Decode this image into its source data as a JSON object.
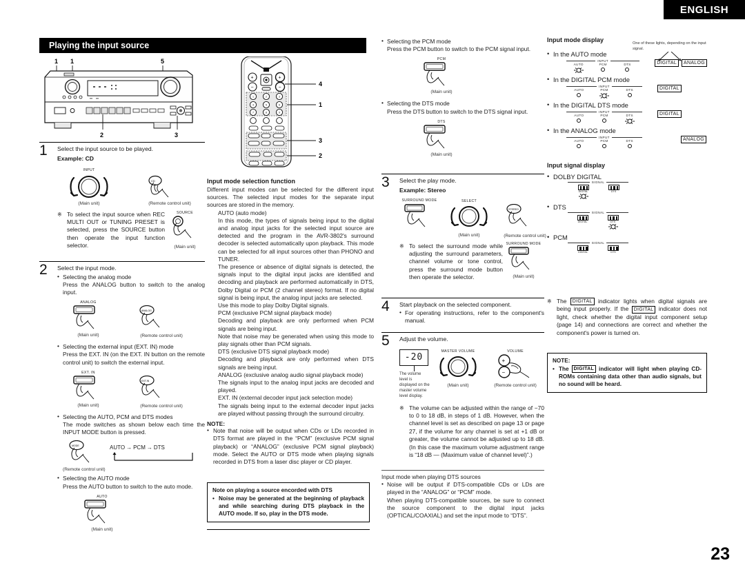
{
  "header": {
    "language_tab": "ENGLISH",
    "section_title": "Playing the input source",
    "page_number": "23"
  },
  "diagrams": {
    "front_panel_callouts": [
      "1",
      "1",
      "5",
      "2",
      "3"
    ],
    "remote_callouts": [
      "4",
      "1",
      "3",
      "2"
    ],
    "caption_main_unit": "(Main unit)",
    "caption_remote": "(Remote control unit)"
  },
  "steps": [
    {
      "num": "1",
      "title": "Select the input source to be played.",
      "example": "Example: CD",
      "knob_label": "INPUT",
      "note_star": "To select the input source when REC MULTI OUT or TUNING PRESET is selected, press the SOURCE button then operate the input function selector.",
      "source_button_label": "SOURCE"
    },
    {
      "num": "2",
      "title": "Select the input mode.",
      "items": [
        {
          "heading": "Selecting the analog mode",
          "text": "Press the ANALOG button to switch to the analog input.",
          "button_label": "ANALOG"
        },
        {
          "heading": "Selecting the external input (EXT. IN) mode",
          "text": "Press the EXT. IN (on the EXT. IN button on the remote control unit) to switch the external input.",
          "button_label": "EXT. IN"
        },
        {
          "heading": "Selecting the AUTO, PCM and DTS modes",
          "text": "The mode switches as shown below each time the INPUT MODE button is pressed.",
          "cycle": [
            "AUTO",
            "PCM",
            "DTS"
          ],
          "button_label": "MODE"
        },
        {
          "heading": "Selecting the AUTO mode",
          "text": "Press the AUTO button to switch to the auto mode.",
          "button_label": "AUTO"
        },
        {
          "heading": "Selecting the PCM mode",
          "text": "Press the PCM button to switch to the PCM signal input.",
          "button_label": "PCM"
        },
        {
          "heading": "Selecting the DTS mode",
          "text": "Press the DTS button to switch to the DTS signal input.",
          "button_label": "DTS"
        }
      ]
    },
    {
      "num": "3",
      "title": "Select the play mode.",
      "example": "Example: Stereo",
      "button_label": "SURROUND MODE",
      "selector_label": "SELECT",
      "remote_button_label": "STEREO",
      "note_star": "To select the surround mode while adjusting the surround parameters, channel volume or tone control, press the surround mode button then operate the selector.",
      "note_button_label": "SURROUND MODE"
    },
    {
      "num": "4",
      "title": "Start playback on the selected component.",
      "bullet": "For operating instructions, refer to the component's manual."
    },
    {
      "num": "5",
      "title": "Adjust the volume.",
      "display_value": "-20",
      "display_caption": "The volume level is displayed on the master volume level display.",
      "knob_label": "MASTER VOLUME",
      "remote_label": "VOLUME",
      "note_star": "The volume can be adjusted within the range of −70 to 0 to 18 dB, in steps of 1 dB. However, when the channel level is set as described on page 13 or page 27, if the volume for any channel is set at +1 dB or greater, the volume cannot be adjusted up to 18 dB. (In this case the maximum volume adjustment range is “18 dB — (Maximum value of channel level)”.)"
    }
  ],
  "input_mode_selection": {
    "heading": "Input mode selection function",
    "intro": "Different input modes can be selected for the different input sources. The selected input modes for the separate input sources are stored in the memory.",
    "paragraphs": [
      "AUTO (auto mode)",
      "In this mode, the types of signals being input to the digital and analog input jacks for the selected input source are detected and the program in the AVR-3802's surround decoder is selected automatically upon playback. This mode can be selected for all input sources other than PHONO and TUNER.",
      "The presence or absence of digital signals is detected, the signals input to the digital input jacks are identified and decoding and playback are performed automatically in DTS, Dolby Digital or PCM (2 channel stereo) format. If no digital signal is being input, the analog input jacks are selected.",
      "Use this mode to play Dolby Digital signals.",
      "PCM (exclusive PCM signal playback mode)",
      "Decoding and playback are only performed when PCM signals are being input.",
      "Note that noise may be generated when using this mode to play signals other than PCM signals.",
      "DTS (exclusive DTS signal playback mode)",
      "Decoding and playback are only performed when DTS signals are being input.",
      "ANALOG (exclusive analog audio signal playback mode)",
      "The signals input to the analog input jacks are decoded and played.",
      "EXT. IN (external decoder input jack selection mode)",
      "The signals being input to the external decoder input jacks are played without passing through the surround circuitry."
    ],
    "note_label": "NOTE:",
    "note_text": "Note that noise will be output when CDs or LDs recorded in DTS format are played in the “PCM” (exclusive PCM signal playback) or “ANALOG” (exclusive PCM signal playback) mode. Select the AUTO or DTS mode when playing signals recorded in DTS from a laser disc player or CD player."
  },
  "dts_note_box": {
    "title": "Note on playing a source encorded with DTS",
    "item": "Noise may be generated at the beginning of playback and while searching during DTS playback in the AUTO mode. If so, play in the DTS mode."
  },
  "dts_input_mode": {
    "heading": "Input mode when playing DTS sources",
    "bullet": "Noise will be output if DTS-compatible CDs or LDs are played in the “ANALOG” or “PCM” mode.",
    "text": "When playing DTS-compatible sources, be sure to connect the source component to the digital input jacks (OPTICAL/COAXIAL) and set the input mode to “DTS”."
  },
  "input_mode_display": {
    "heading": "Input mode display",
    "legend": "One of these lights, depending on the input signal.",
    "input_group_label": "INPUT",
    "lamp_names": [
      "AUTO",
      "PCM",
      "DTS"
    ],
    "rows": [
      {
        "label": "In the AUTO mode",
        "lit": 0,
        "indicators": [
          "DIGITAL",
          "ANALOG"
        ]
      },
      {
        "label": "In the DIGITAL PCM mode",
        "lit": 1,
        "indicators": [
          "DIGITAL"
        ]
      },
      {
        "label": "In the DIGITAL DTS mode",
        "lit": 2,
        "indicators": [
          "DIGITAL"
        ]
      },
      {
        "label": "In the ANALOG mode",
        "lit": -1,
        "indicators": [
          "ANALOG"
        ]
      }
    ]
  },
  "input_signal_display": {
    "heading": "Input signal display",
    "signal_group_label": "SIGNAL",
    "icon_labels": [
      "DIGITAL",
      "DTS"
    ],
    "rows": [
      {
        "label": "DOLBY DIGITAL",
        "lit": 0
      },
      {
        "label": "DTS",
        "lit": 1
      },
      {
        "label": "PCM",
        "lit": -1
      }
    ],
    "star_note_a": "The ",
    "star_note_badge1": "DIGITAL",
    "star_note_b": " indicator lights when digital signals are being input properly. If the ",
    "star_note_badge2": "DIGITAL",
    "star_note_c": " indicator does not light, check whether the digital input component setup (page 14) and connections are correct and whether the component's power is turned on."
  },
  "digital_note_box": {
    "title": "NOTE:",
    "text_a": "The ",
    "badge": "DIGITAL",
    "text_b": " indicator will light when playing CD-ROMs containing data other than audio signals, but no sound will be heard."
  }
}
